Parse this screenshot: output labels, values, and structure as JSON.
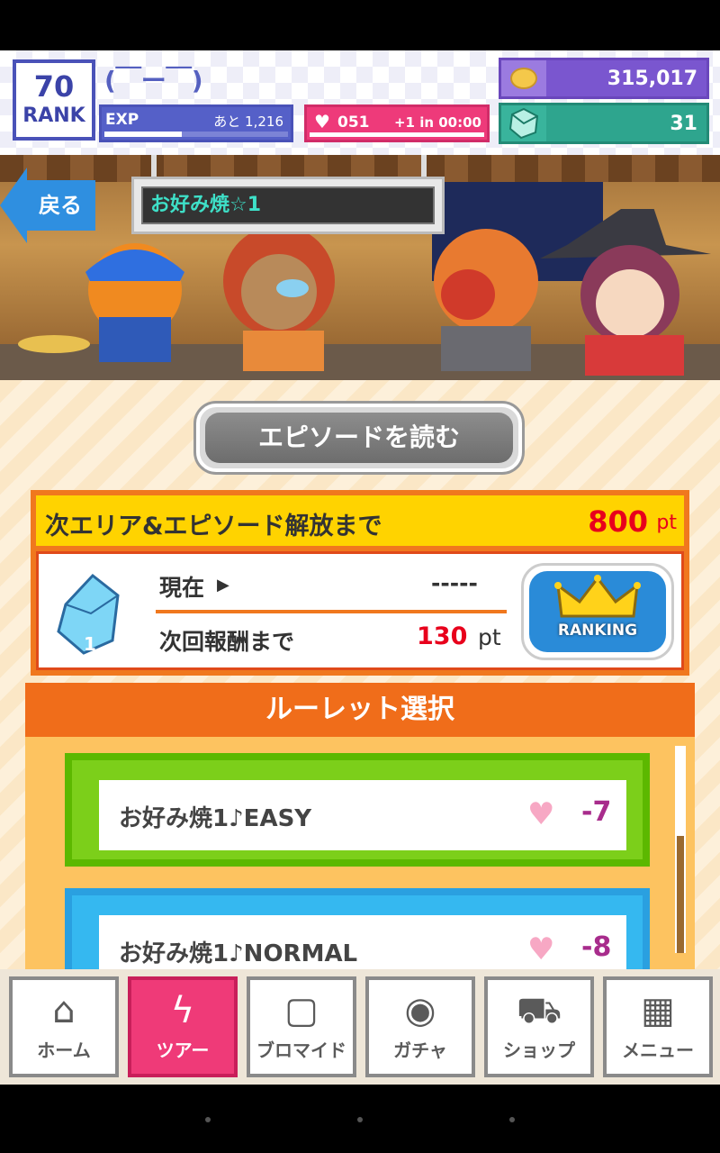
{
  "header": {
    "rank_value": "70",
    "rank_label": "RANK",
    "player_name": "(￣ー￣)",
    "exp_label": "EXP",
    "exp_remaining": "あと 1,216",
    "exp_progress": 0.42,
    "hp_value": "051",
    "hp_timer": "+1 in 00:00",
    "coins": "315,017",
    "gems": "31"
  },
  "banner": {
    "back_label": "戻る",
    "area_name": "お好み焼☆1"
  },
  "episode": {
    "read_label": "エピソードを読む"
  },
  "next_area": {
    "label": "次エリア&エピソード解放まで",
    "value": "800",
    "unit": "pt",
    "current_label": "現在",
    "current_value": "-----",
    "reward_label": "次回報酬まで",
    "reward_value": "130",
    "reward_unit": "pt",
    "crystal_count": "1",
    "ranking_label": "RANKING"
  },
  "roulette": {
    "title": "ルーレット選択",
    "items": [
      {
        "label": "お好み焼1♪EASY",
        "cost": "-7"
      },
      {
        "label": "お好み焼1♪NORMAL",
        "cost": "-8"
      }
    ]
  },
  "nav": [
    {
      "label": "ホーム",
      "icon": "home-icon",
      "glyph": "⌂"
    },
    {
      "label": "ツアー",
      "icon": "lightning-icon",
      "glyph": "ϟ"
    },
    {
      "label": "ブロマイド",
      "icon": "photo-cards-icon",
      "glyph": "▢"
    },
    {
      "label": "ガチャ",
      "icon": "camera-icon",
      "glyph": "◉"
    },
    {
      "label": "ショップ",
      "icon": "cart-icon",
      "glyph": "⛟"
    },
    {
      "label": "メニュー",
      "icon": "grid-menu-icon",
      "glyph": "▦"
    }
  ],
  "colors": {
    "accent_orange": "#f06d1a",
    "accent_pink": "#ef3a78",
    "rank_blue": "#4a52b8",
    "easy_green": "#7ccf1a",
    "normal_blue": "#35b8f0"
  }
}
